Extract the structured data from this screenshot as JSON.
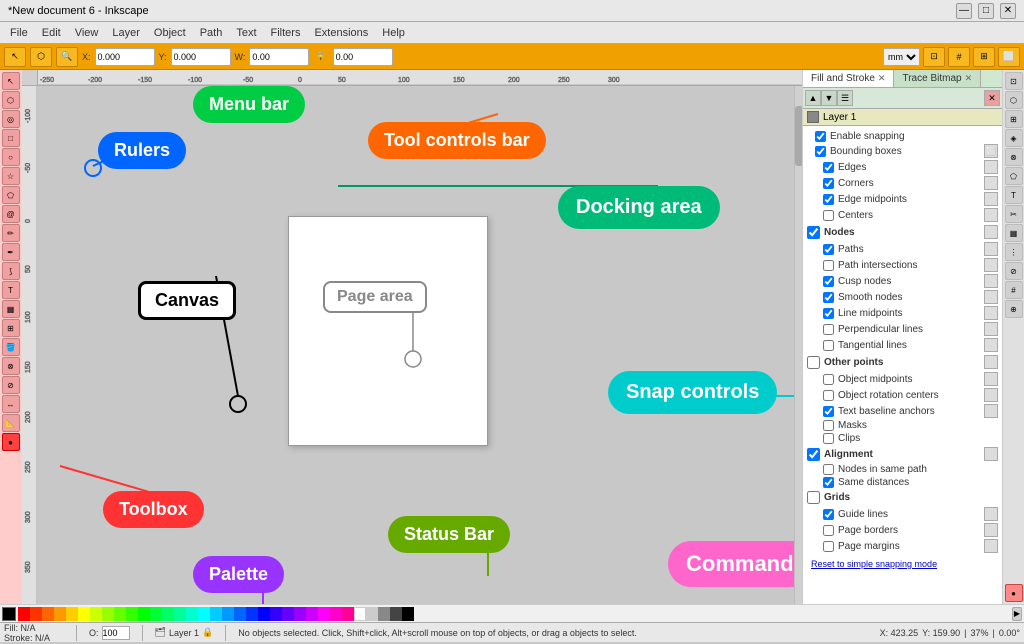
{
  "titlebar": {
    "title": "*New document 6 - Inkscape",
    "btn_minimize": "—",
    "btn_maximize": "□",
    "btn_close": "✕"
  },
  "menubar": {
    "items": [
      "File",
      "Edit",
      "View",
      "Layer",
      "Object",
      "Path",
      "Text",
      "Filters",
      "Extensions",
      "Help"
    ]
  },
  "toolcontrols": {
    "label": "Tool controls bar",
    "fields": [
      "X: 0.000",
      "Y: 0.000",
      "W: 0.00",
      "H: 0.00"
    ],
    "unit": "mm"
  },
  "toolbox": {
    "label": "Toolbox",
    "tools": [
      "↖",
      "⬡",
      "□",
      "○",
      "✎",
      "✏",
      "T",
      "⬠",
      "🪣",
      "🔍",
      "📐",
      "↔",
      "✂",
      "🖊",
      "📝",
      "⬟",
      "☆",
      "⚙"
    ]
  },
  "canvas": {
    "label": "Canvas",
    "page_area_label": "Page area"
  },
  "annotations": {
    "menu_bar": "Menu bar",
    "tool_controls_bar": "Tool controls bar",
    "rulers": "Rulers",
    "canvas": "Canvas",
    "page_area": "Page area",
    "toolbox": "Toolbox",
    "status_bar": "Status Bar",
    "palette": "Palette",
    "docking_area": "Docking area",
    "snap_controls": "Snap controls",
    "commands_bar": "Commands bar"
  },
  "dock": {
    "tabs": [
      "Fill and Stroke",
      "Trace Bitmap"
    ],
    "layer": "Layer 1"
  },
  "snap_panel": {
    "title": "Snap controls",
    "sections": [
      {
        "name": "main",
        "items": [
          {
            "label": "Enable snapping",
            "checked": true
          },
          {
            "label": "Bounding boxes",
            "checked": true
          }
        ]
      },
      {
        "name": "bounding_boxes",
        "items": [
          {
            "label": "Edges",
            "checked": true
          },
          {
            "label": "Corners",
            "checked": true
          },
          {
            "label": "Edge midpoints",
            "checked": true
          },
          {
            "label": "Centers",
            "checked": false
          }
        ]
      },
      {
        "name": "nodes",
        "header": "Nodes",
        "items": [
          {
            "label": "Paths",
            "checked": true
          },
          {
            "label": "Path intersections",
            "checked": false
          },
          {
            "label": "Cusp nodes",
            "checked": true
          },
          {
            "label": "Smooth nodes",
            "checked": true
          },
          {
            "label": "Line midpoints",
            "checked": true
          },
          {
            "label": "Perpendicular lines",
            "checked": false
          },
          {
            "label": "Tangential lines",
            "checked": false
          }
        ]
      },
      {
        "name": "other_points",
        "header": "Other points",
        "items": [
          {
            "label": "Object midpoints",
            "checked": false
          },
          {
            "label": "Object rotation centers",
            "checked": false
          },
          {
            "label": "Text baseline anchors",
            "checked": true
          },
          {
            "label": "Masks",
            "checked": false
          },
          {
            "label": "Clips",
            "checked": false
          }
        ]
      },
      {
        "name": "alignment",
        "header": "Alignment",
        "items": [
          {
            "label": "Nodes in same path",
            "checked": false
          },
          {
            "label": "Same distances",
            "checked": true
          }
        ]
      },
      {
        "name": "grids",
        "header": "Grids",
        "items": [
          {
            "label": "Guide lines",
            "checked": true
          },
          {
            "label": "Page borders",
            "checked": false
          },
          {
            "label": "Page margins",
            "checked": false
          }
        ]
      }
    ],
    "reset_label": "Reset to simple snapping mode"
  },
  "statusbar": {
    "layer": "Layer 1",
    "message": "No objects selected. Click, Shift+click, Alt+scroll mouse on top of objects, or drag a",
    "select_label": "objects to select.",
    "fill_label": "Fill:",
    "fill_value": "N/A",
    "stroke_label": "Stroke:",
    "stroke_value": "N/A",
    "opacity_label": "O:",
    "opacity_value": "100",
    "coords": "X: 423.25",
    "coords_y": "Y: 159.90",
    "zoom": "37%",
    "rotation": "0.00°"
  },
  "colors": {
    "menu_bar_annotation": "#00cc44",
    "tool_controls_annotation": "#ff6600",
    "rulers_annotation": "#0066ff",
    "canvas_annotation": "#000000",
    "page_area_annotation": "#888888",
    "toolbox_annotation": "#ff3333",
    "status_bar_annotation": "#66aa00",
    "palette_annotation": "#9933ff",
    "docking_area_annotation": "#009966",
    "snap_controls_annotation": "#00cccc",
    "commands_bar_annotation": "#ff66cc",
    "toolcontrols_bg": "#f0a000",
    "right_panel_bg": "#ffff99",
    "snap_panel_bg": "#80e0e0"
  }
}
